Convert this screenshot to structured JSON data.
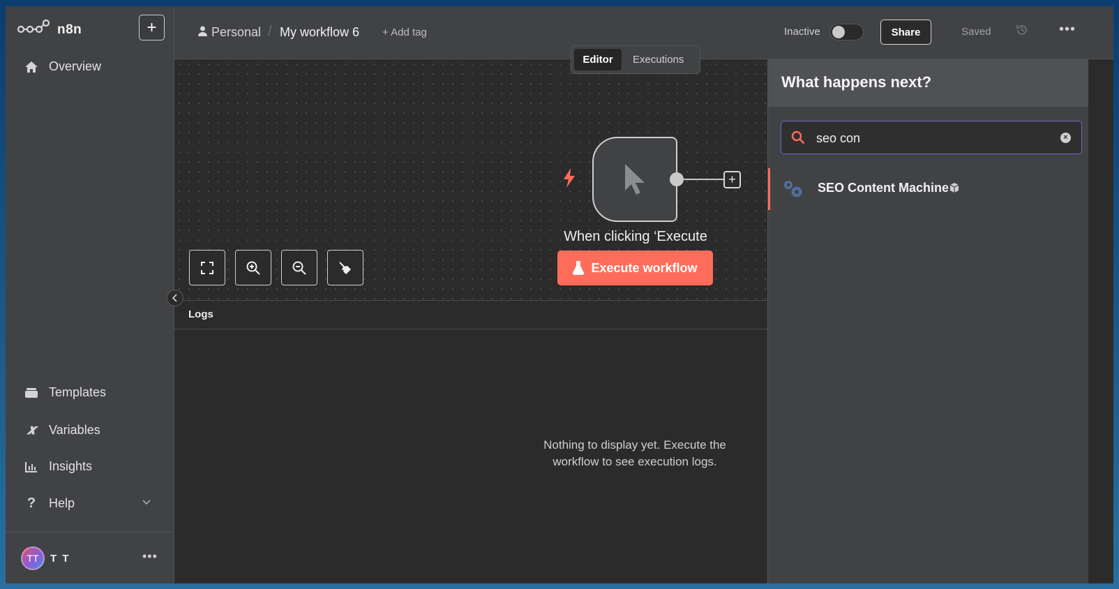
{
  "brand": {
    "name": "n8n"
  },
  "sidebar": {
    "new_button": "+",
    "top_items": [
      {
        "label": "Overview",
        "icon": "home-icon"
      }
    ],
    "bottom_items": [
      {
        "label": "Templates",
        "icon": "templates-icon"
      },
      {
        "label": "Variables",
        "icon": "variables-icon"
      },
      {
        "label": "Insights",
        "icon": "insights-icon"
      },
      {
        "label": "Help",
        "icon": "help-icon"
      }
    ],
    "user": {
      "initials": "TT",
      "name": "T T",
      "more": "•••"
    }
  },
  "header": {
    "breadcrumb": {
      "project": "Personal",
      "separator": "/",
      "workflow": "My workflow 6"
    },
    "add_tag": "+ Add tag",
    "status_label": "Inactive",
    "active": false,
    "share_label": "Share",
    "saved_label": "Saved",
    "more": "•••"
  },
  "tabs": [
    {
      "label": "Editor",
      "active": true
    },
    {
      "label": "Executions",
      "active": false
    }
  ],
  "canvas": {
    "node": {
      "label": "When clicking ‘Execute workflow’",
      "label_visible": "When clicking ‘Execute"
    },
    "execute_button": "Execute workflow",
    "add_node": "+"
  },
  "logs": {
    "title": "Logs",
    "empty_message": "Nothing to display yet. Execute the workflow to see execution logs."
  },
  "node_panel": {
    "title": "What happens next?",
    "search_value": "seo con",
    "results": [
      {
        "name": "SEO Content Machine",
        "icon": "gears-icon",
        "badge": "package-icon"
      }
    ]
  },
  "colors": {
    "accent": "#ff6d5a",
    "sidebar_bg": "#414244",
    "canvas_bg": "#2b2b2c",
    "focus_border": "#6e67c9"
  }
}
